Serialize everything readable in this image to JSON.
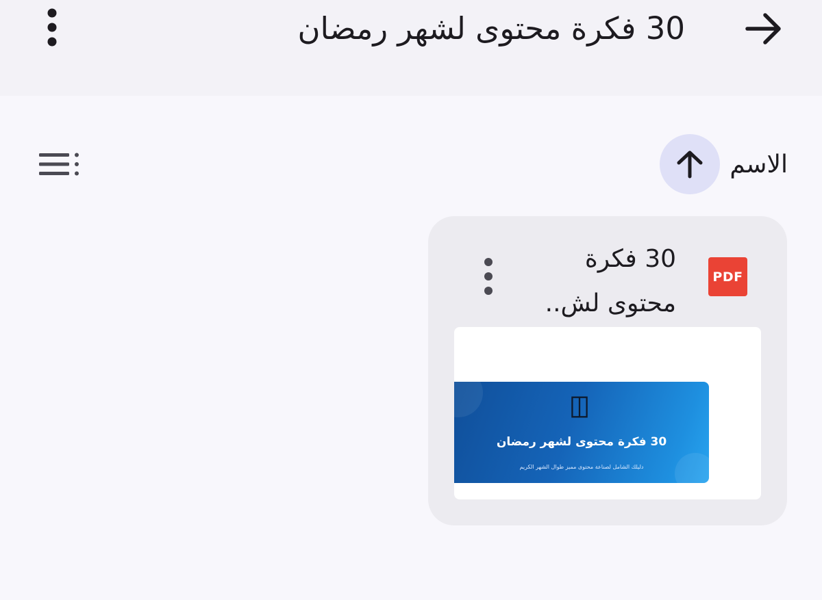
{
  "header": {
    "title": "30 فكرة محتوى لشهر رمضان",
    "back_icon": "arrow-right-icon",
    "menu_icon": "more-vertical-icon"
  },
  "sort": {
    "label": "الاسم",
    "direction_icon": "arrow-up-icon"
  },
  "view_toggle_icon": "list-view-icon",
  "files": [
    {
      "type_label": "PDF",
      "type_color": "#ea4335",
      "name": "30 فكرة محتوى لش..",
      "thumbnail": {
        "title": "30 فكرة محتوى لشهر رمضان",
        "subtitle": "دليلك الشامل لصناعة محتوى مميز طوال الشهر الكريم"
      }
    }
  ],
  "colors": {
    "topbar": "#f3f2f7",
    "background": "#f8f7fc",
    "card": "#ecebf0",
    "sort_button": "#dfe0f7",
    "banner_dark": "#104f9a",
    "banner_light": "#28a4ef"
  }
}
